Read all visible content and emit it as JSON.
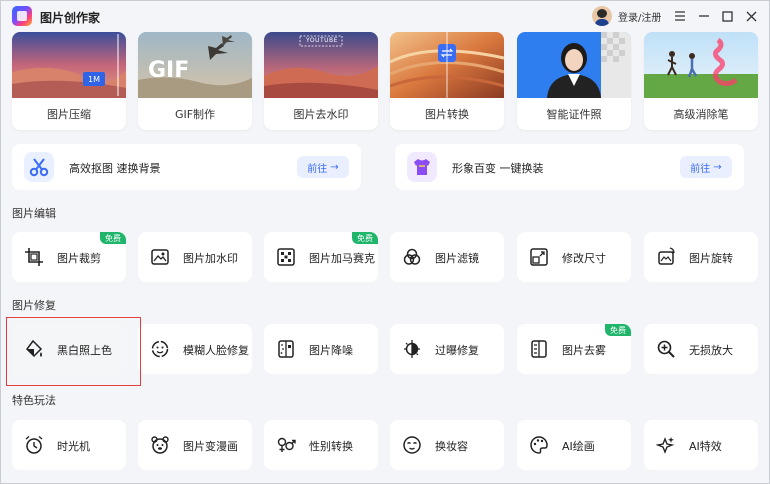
{
  "app": {
    "title": "图片创作家",
    "login_label": "登录/注册"
  },
  "top_cards": [
    {
      "label": "图片压缩",
      "badge_text": "1M"
    },
    {
      "label": "GIF制作",
      "overlay_text": "GIF"
    },
    {
      "label": "图片去水印",
      "overlay_text": "YOUTUBE"
    },
    {
      "label": "图片转换"
    },
    {
      "label": "智能证件照"
    },
    {
      "label": "高级消除笔"
    }
  ],
  "promos": [
    {
      "text": "高效抠图 速换背景",
      "go_label": "前往"
    },
    {
      "text": "形象百变 一键换装",
      "go_label": "前往"
    }
  ],
  "sections": {
    "edit": "图片编辑",
    "repair": "图片修复",
    "fun": "特色玩法"
  },
  "edit_tools": [
    {
      "label": "图片裁剪",
      "badge": "免费"
    },
    {
      "label": "图片加水印",
      "badge": ""
    },
    {
      "label": "图片加马赛克",
      "badge": "免费"
    },
    {
      "label": "图片滤镜",
      "badge": ""
    },
    {
      "label": "修改尺寸",
      "badge": ""
    },
    {
      "label": "图片旋转",
      "badge": ""
    }
  ],
  "repair_tools": [
    {
      "label": "黑白照上色",
      "badge": ""
    },
    {
      "label": "模糊人脸修复",
      "badge": ""
    },
    {
      "label": "图片降噪",
      "badge": ""
    },
    {
      "label": "过曝修复",
      "badge": ""
    },
    {
      "label": "图片去雾",
      "badge": "免费"
    },
    {
      "label": "无损放大",
      "badge": ""
    }
  ],
  "fun_tools": [
    {
      "label": "时光机",
      "badge": ""
    },
    {
      "label": "图片变漫画",
      "badge": ""
    },
    {
      "label": "性别转换",
      "badge": ""
    },
    {
      "label": "换妆容",
      "badge": ""
    },
    {
      "label": "AI绘画",
      "badge": ""
    },
    {
      "label": "AI特效",
      "badge": ""
    }
  ],
  "colors": {
    "accent": "#3b6cf6",
    "free_badge": "#1fb66b",
    "highlight": "#e04040"
  }
}
